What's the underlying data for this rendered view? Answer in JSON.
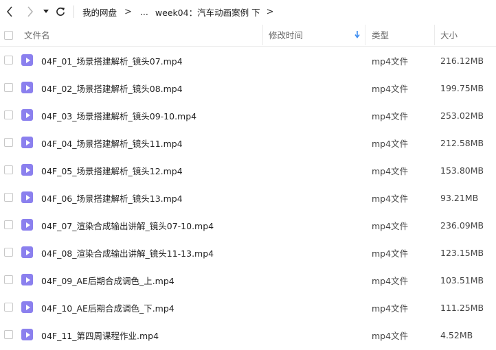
{
  "nav": {
    "breadcrumb": {
      "root": "我的网盘",
      "ellipsis": "...",
      "current": "week04：汽车动画案例 下",
      "separator": ">"
    }
  },
  "columns": {
    "name": "文件名",
    "modified": "修改时间",
    "type": "类型",
    "size": "大小"
  },
  "files": [
    {
      "name": "04F_01_场景搭建解析_镜头07.mp4",
      "type": "mp4文件",
      "size": "216.12MB"
    },
    {
      "name": "04F_02_场景搭建解析_镜头08.mp4",
      "type": "mp4文件",
      "size": "199.75MB"
    },
    {
      "name": "04F_03_场景搭建解析_镜头09-10.mp4",
      "type": "mp4文件",
      "size": "253.02MB"
    },
    {
      "name": "04F_04_场景搭建解析_镜头11.mp4",
      "type": "mp4文件",
      "size": "212.58MB"
    },
    {
      "name": "04F_05_场景搭建解析_镜头12.mp4",
      "type": "mp4文件",
      "size": "153.80MB"
    },
    {
      "name": "04F_06_场景搭建解析_镜头13.mp4",
      "type": "mp4文件",
      "size": "93.21MB"
    },
    {
      "name": "04F_07_渲染合成输出讲解_镜头07-10.mp4",
      "type": "mp4文件",
      "size": "236.09MB"
    },
    {
      "name": "04F_08_渲染合成输出讲解_镜头11-13.mp4",
      "type": "mp4文件",
      "size": "123.15MB"
    },
    {
      "name": "04F_09_AE后期合成调色_上.mp4",
      "type": "mp4文件",
      "size": "103.51MB"
    },
    {
      "name": "04F_10_AE后期合成调色_下.mp4",
      "type": "mp4文件",
      "size": "111.25MB"
    },
    {
      "name": "04F_11_第四周课程作业.mp4",
      "type": "mp4文件",
      "size": "4.52MB"
    }
  ],
  "colors": {
    "file_icon": "#8b80ee",
    "sort_arrow": "#3b8cf0"
  },
  "icons": {
    "back": "chevron-left-icon",
    "forward": "chevron-right-icon",
    "history": "caret-down-icon",
    "refresh": "refresh-icon",
    "sort": "arrow-down-icon",
    "file": "video-file-icon"
  }
}
